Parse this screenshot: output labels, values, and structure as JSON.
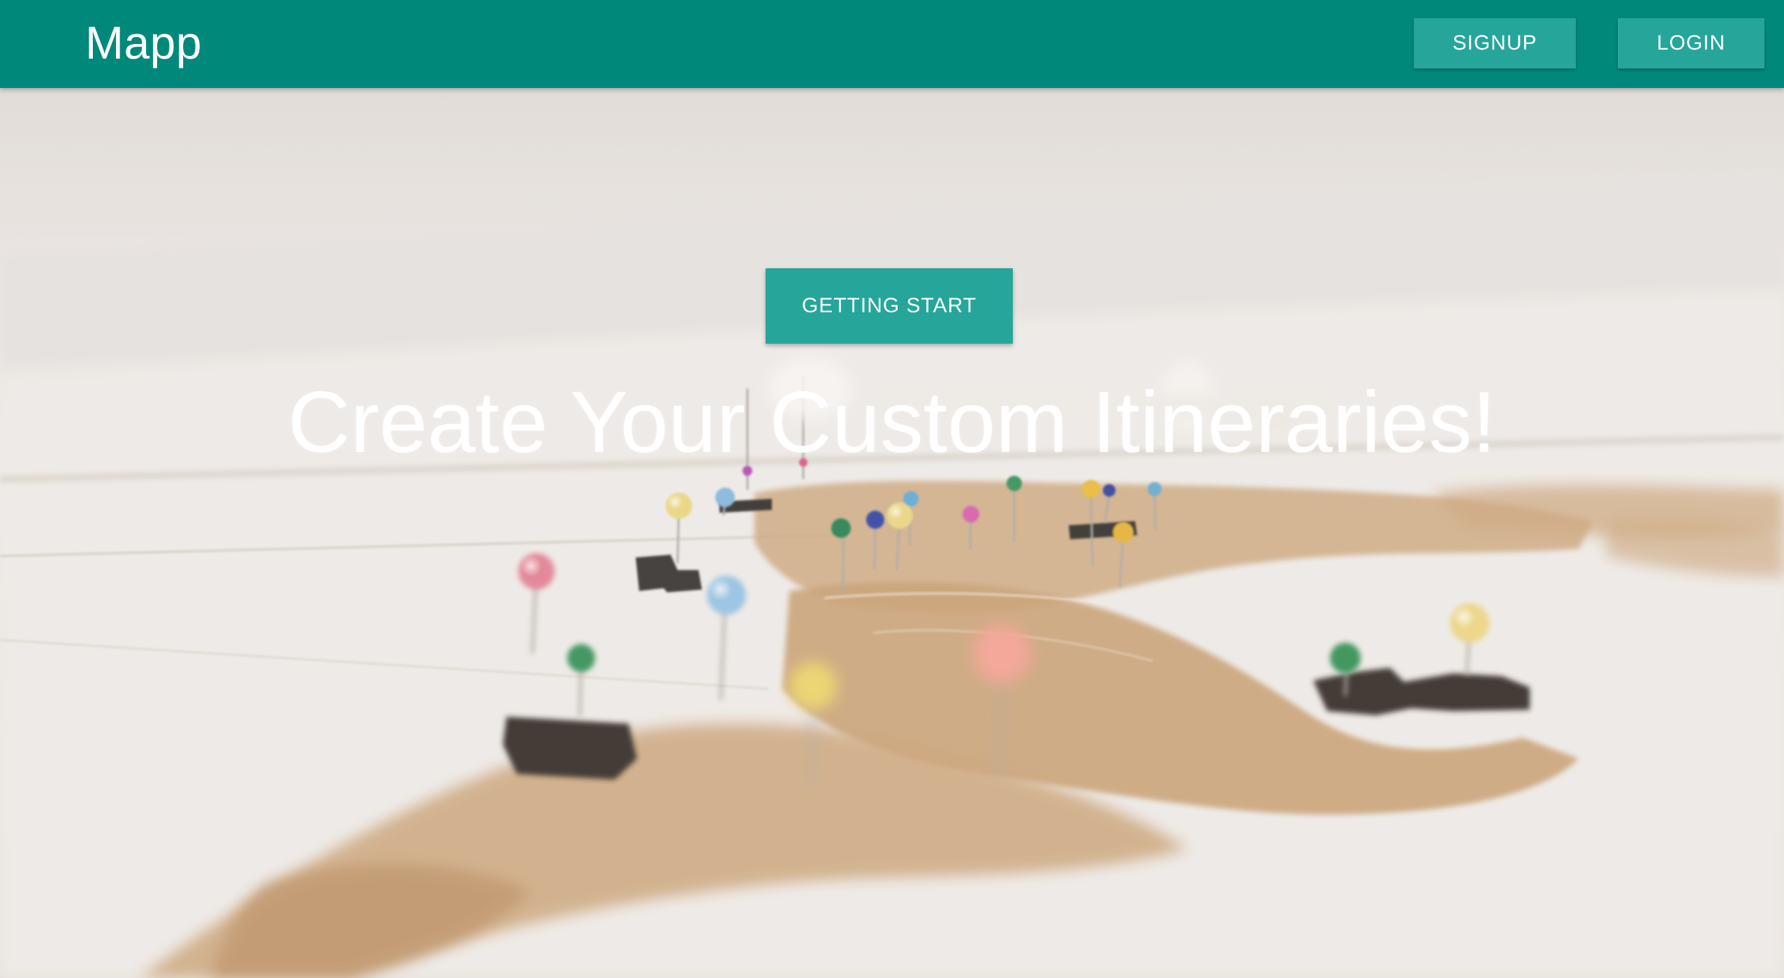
{
  "app": {
    "brand": "Mapp"
  },
  "navbar": {
    "signup_label": "SIGNUP",
    "login_label": "LOGIN"
  },
  "hero": {
    "cta_label": "GETTING START",
    "headline": "Create Your Custom Itineraries!",
    "background_description_icon": "world-map-with-pins-image"
  },
  "colors": {
    "navbar": "#00897b",
    "button": "#26a69a",
    "text": "#ffffff"
  }
}
